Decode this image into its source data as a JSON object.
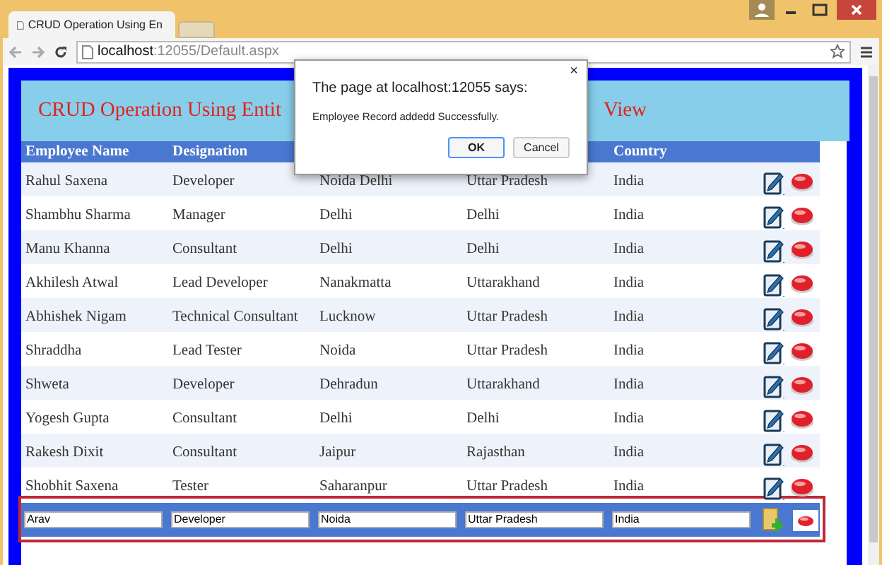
{
  "browser": {
    "tab_title": "CRUD Operation Using En",
    "address_host": "localhost",
    "address_rest": ":12055/Default.aspx"
  },
  "page": {
    "title_left": "CRUD Operation Using Entit",
    "title_right": "View"
  },
  "table": {
    "columns": [
      "Employee Name",
      "Designation",
      "",
      "",
      "Country"
    ],
    "rows": [
      {
        "cells": [
          "Rahul Saxena",
          "Developer",
          "Noida Delhi",
          "Uttar Pradesh",
          "India"
        ]
      },
      {
        "cells": [
          "Shambhu Sharma",
          "Manager",
          "Delhi",
          "Delhi",
          "India"
        ]
      },
      {
        "cells": [
          "Manu Khanna",
          "Consultant",
          "Delhi",
          "Delhi",
          "India"
        ]
      },
      {
        "cells": [
          "Akhilesh Atwal",
          "Lead Developer",
          "Nanakmatta",
          "Uttarakhand",
          "India"
        ]
      },
      {
        "cells": [
          "Abhishek Nigam",
          "Technical Consultant",
          "Lucknow",
          "Uttar Pradesh",
          "India"
        ]
      },
      {
        "cells": [
          "Shraddha",
          "Lead Tester",
          "Noida",
          "Uttar Pradesh",
          "India"
        ]
      },
      {
        "cells": [
          "Shweta",
          "Developer",
          "Dehradun",
          "Uttarakhand",
          "India"
        ]
      },
      {
        "cells": [
          "Yogesh Gupta",
          "Consultant",
          "Delhi",
          "Delhi",
          "India"
        ]
      },
      {
        "cells": [
          "Rakesh Dixit",
          "Consultant",
          "Jaipur",
          "Rajasthan",
          "India"
        ]
      },
      {
        "cells": [
          "Shobhit Saxena",
          "Tester",
          "Saharanpur",
          "Uttar Pradesh",
          "India"
        ]
      }
    ],
    "insert_row": {
      "values": [
        "Arav",
        "Developer",
        "Noida",
        "Uttar Pradesh",
        "India"
      ]
    }
  },
  "dialog": {
    "heading": "The page at localhost:12055 says:",
    "message": "Employee Record addedd Successfully.",
    "close": "×",
    "buttons": [
      "OK",
      "Cancel"
    ]
  }
}
